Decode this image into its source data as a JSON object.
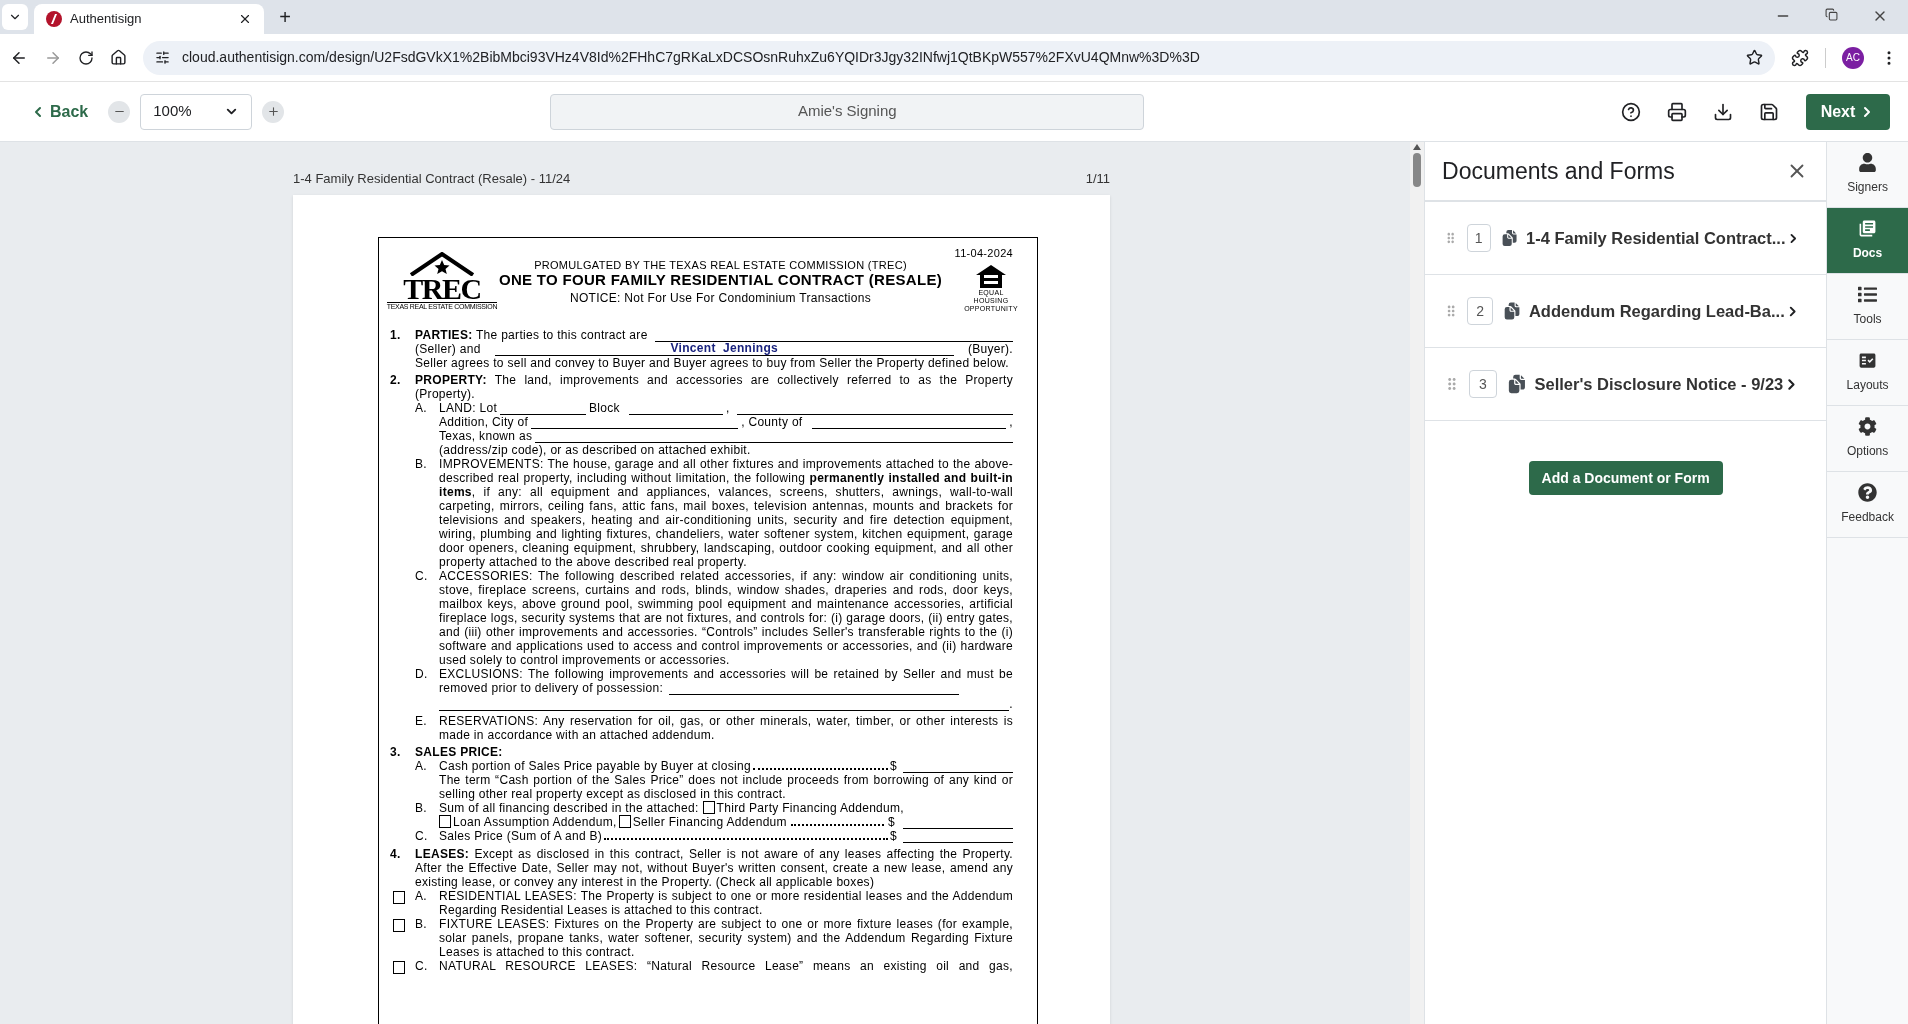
{
  "browser": {
    "tab_title": "Authentisign",
    "new_tab": "+",
    "url": "cloud.authentisign.com/design/U2FsdGVkX1%2BibMbci93VHz4V8Id%2FHhC7gRKaLxDCSOsnRuhxZu6YQIDr3Jgy32INfwj1QtBKpW557%2FXvU4QMnw%3D%3D",
    "profile": "AC"
  },
  "toolbar": {
    "back": "Back",
    "zoom": "100%",
    "signing_name": "Amie's Signing",
    "next": "Next"
  },
  "viewer": {
    "document_title": "1-4 Family Residential Contract (Resale) - 11/24",
    "page": "1/11"
  },
  "form": {
    "date": "11-04-2024",
    "promulgated": "PROMULGATED BY THE TEXAS REAL ESTATE COMMISSION (TREC)",
    "title": "ONE TO FOUR FAMILY RESIDENTIAL CONTRACT (RESALE)",
    "notice": "NOTICE: Not For Use For Condominium Transactions",
    "logo": {
      "mark": "TREC",
      "caption": "TEXAS REAL ESTATE COMMISSION"
    },
    "housing_caption": "EQUAL HOUSING OPPORTUNITY",
    "parties": {
      "number": "1.",
      "heading": "PARTIES:",
      "lead": "The parties to this contract are",
      "seller_label": "(Seller) and",
      "buyer": "Vincent  Jennings",
      "buyer_label": "(Buyer).",
      "text": "Seller agrees to sell and convey to Buyer and Buyer agrees to buy from Seller the Property defined below."
    },
    "property": {
      "number": "2.",
      "heading": "PROPERTY:",
      "text": "The land, improvements and accessories are collectively referred to as the Property (Property).",
      "land": {
        "letter": "A.",
        "lot": "LAND: Lot",
        "block": "Block",
        "comma": ",",
        "addition": "Addition, City of",
        "county": ", County of",
        "comma2": ",",
        "known_as": "Texas, known as",
        "tail": "(address/zip code), or as described on attached exhibit."
      },
      "paragraphs": [
        {
          "letter": "B.",
          "text": "IMPROVEMENTS: The house, garage and all other fixtures and improvements attached to the above-described real property, including without limitation, the following **permanently installed and built-in items**, if any: all equipment and appliances, valances, screens, shutters, awnings, wall-to-wall carpeting, mirrors, ceiling fans, attic fans, mail boxes, television antennas, mounts and brackets for televisions and speakers, heating and air-conditioning units, security and fire detection equipment, wiring, plumbing and lighting fixtures, chandeliers, water softener system, kitchen equipment, garage door openers, cleaning equipment, shrubbery, landscaping, outdoor cooking equipment, and all other property attached to the above described real property."
        },
        {
          "letter": "C.",
          "text": "ACCESSORIES: The following described related accessories, if any: window air conditioning units, stove, fireplace screens, curtains and rods, blinds, window shades, draperies and rods, door keys, mailbox keys, above ground pool, swimming pool equipment and maintenance accessories, artificial fireplace logs, security systems that are not fixtures, and controls for: (i) garage doors, (ii) entry gates, and (iii) other improvements and accessories. “Controls” includes Seller's transferable rights to the (i) software and applications used to access and control improvements or accessories, and (ii) hardware used solely to control improvements or accessories."
        }
      ],
      "exclusions": {
        "letter": "D.",
        "text": "EXCLUSIONS: The following improvements and accessories will be retained by Seller and must be removed prior to delivery of possession:",
        "end": "."
      },
      "reservations": {
        "letter": "E.",
        "text": "RESERVATIONS: Any reservation for oil, gas, or other minerals, water, timber, or other interests is made in accordance with an attached addendum."
      }
    },
    "sales_price": {
      "number": "3.",
      "heading": "SALES PRICE:",
      "a": {
        "letter": "A.",
        "text": "Cash portion of Sales Price payable by Buyer at closing",
        "currency": "$",
        "note": "The term “Cash portion of the Sales Price” does not include proceeds from borrowing of any kind or selling other real property except as disclosed in this contract."
      },
      "b": {
        "letter": "B.",
        "text": "Sum of all financing described in the attached:",
        "currency": "$",
        "options": [
          {
            "label": "Third Party Financing Addendum,",
            "checked": false
          },
          {
            "label": "Loan Assumption Addendum,",
            "checked": false
          },
          {
            "label": "Seller Financing Addendum",
            "checked": false
          }
        ]
      },
      "c": {
        "letter": "C.",
        "text": "Sales Price (Sum of A and B)",
        "currency": "$"
      }
    },
    "leases": {
      "number": "4.",
      "heading": "LEASES:",
      "text": "Except as disclosed in this contract, Seller is not aware of any leases affecting the Property. After the Effective Date, Seller may not, without Buyer's written consent, create a new lease, amend any existing lease, or convey any interest in the Property. (Check all applicable boxes)",
      "options": [
        {
          "letter": "A.",
          "text": "RESIDENTIAL LEASES: The Property is subject to one or more residential leases and the Addendum Regarding Residential Leases is attached to this contract.",
          "checked": false
        },
        {
          "letter": "B.",
          "text": "FIXTURE LEASES: Fixtures on the Property are subject to one or more fixture leases (for example, solar panels, propane tanks, water softener, security system) and the Addendum Regarding Fixture Leases is attached to this contract.",
          "checked": false
        },
        {
          "letter": "C.",
          "text": "NATURAL RESOURCE LEASES: “Natural Resource Lease” means an existing oil and gas,",
          "checked": false
        }
      ]
    }
  },
  "panel": {
    "title": "Documents and Forms",
    "documents": [
      {
        "number": "1",
        "name": "1-4 Family Residential Contract..."
      },
      {
        "number": "2",
        "name": "Addendum Regarding Lead-Ba..."
      },
      {
        "number": "3",
        "name": "Seller's Disclosure Notice - 9/23"
      }
    ],
    "add_button": "Add a Document or Form"
  },
  "rail": [
    {
      "kind": "signers",
      "label": "Signers",
      "selected": false
    },
    {
      "kind": "docs",
      "label": "Docs",
      "selected": true
    },
    {
      "kind": "tools",
      "label": "Tools",
      "selected": false
    },
    {
      "kind": "layouts",
      "label": "Layouts",
      "selected": false
    },
    {
      "kind": "options",
      "label": "Options",
      "selected": false
    },
    {
      "kind": "feedback",
      "label": "Feedback",
      "selected": false
    }
  ]
}
